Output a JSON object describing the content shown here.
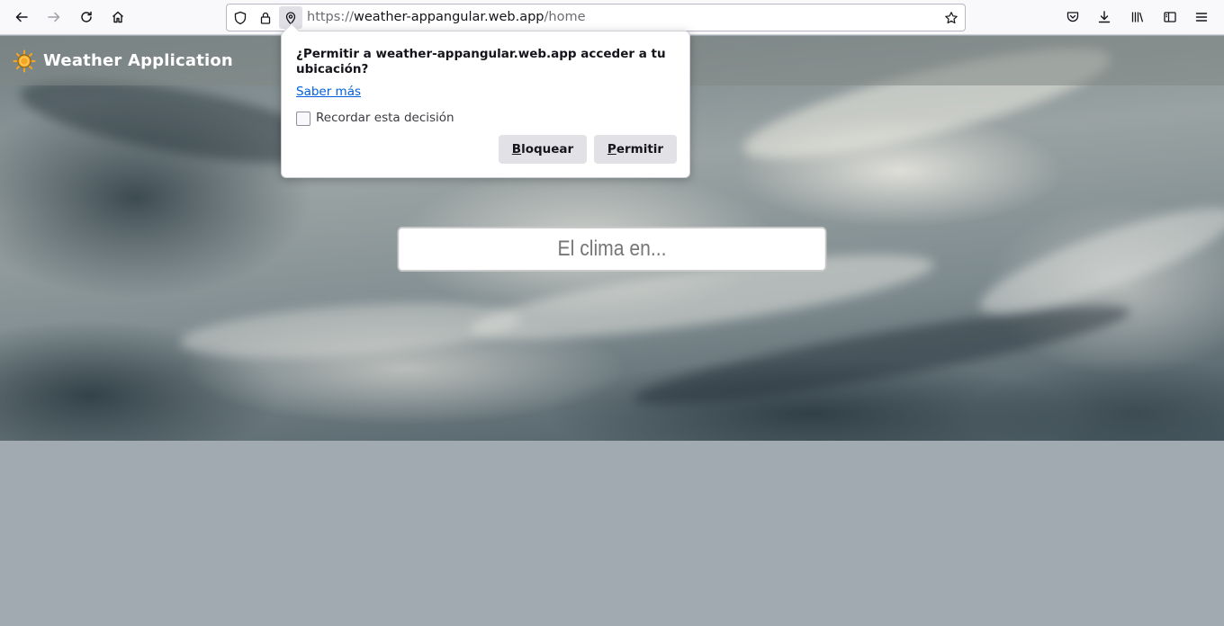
{
  "browser": {
    "url_prefix": "https://",
    "url_host": "weather-appangular.web.app",
    "url_path": "/home",
    "icons": {
      "back": "arrow-left-icon",
      "forward": "arrow-right-icon",
      "reload": "reload-icon",
      "home": "home-icon",
      "tracking": "shield-icon",
      "lock": "lock-icon",
      "location": "location-pin-icon",
      "bookmark": "star-icon",
      "pocket": "pocket-icon",
      "downloads": "download-icon",
      "library": "library-icon",
      "sidebar": "sidebar-icon",
      "menu": "hamburger-menu-icon"
    }
  },
  "app": {
    "title": "Weather Application",
    "logo_icon": "sun-icon",
    "search_placeholder": "El clima en..."
  },
  "permission_popup": {
    "question": "¿Permitir a weather-appangular.web.app acceder a tu ubicación?",
    "learn_more": "Saber más",
    "remember_label": "Recordar esta decisión",
    "remember_checked": false,
    "block_first": "B",
    "block_rest": "loquear",
    "allow_first": "P",
    "allow_rest": "ermitir"
  },
  "colors": {
    "page_background": "#a1aab1",
    "link": "#0061e0",
    "logo_sun": "#f5a623"
  }
}
